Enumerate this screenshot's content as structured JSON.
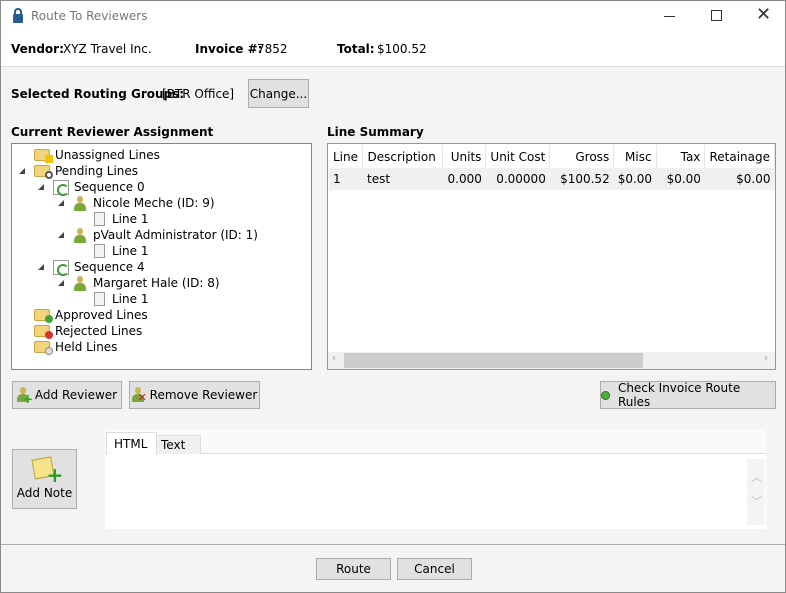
{
  "window": {
    "title": "Route To Reviewers",
    "controls": [
      "minimize",
      "maximize",
      "close"
    ]
  },
  "header": {
    "vendor_label": "Vendor:",
    "vendor": "XYZ Travel Inc.",
    "invoice_label": "Invoice #:",
    "invoice": "7852",
    "total_label": "Total:",
    "total": "$100.52"
  },
  "routing": {
    "label": "Selected Routing Groups:",
    "value": "[BTR Office]",
    "change_button": "Change..."
  },
  "tree": {
    "title": "Current Reviewer Assignment",
    "nodes": [
      {
        "label": "Unassigned Lines",
        "icon": "folder-warning-icon"
      },
      {
        "label": "Pending Lines",
        "icon": "folder-search-icon"
      },
      {
        "label": "Sequence 0",
        "icon": "sequence-icon"
      },
      {
        "label": "Nicole Meche (ID: 9)",
        "icon": "user-icon"
      },
      {
        "label": "Line 1",
        "icon": "document-icon"
      },
      {
        "label": "pVault Administrator (ID: 1)",
        "icon": "user-icon"
      },
      {
        "label": "Line 1",
        "icon": "document-icon"
      },
      {
        "label": "Sequence 4",
        "icon": "sequence-icon"
      },
      {
        "label": "Margaret Hale (ID: 8)",
        "icon": "user-icon"
      },
      {
        "label": "Line 1",
        "icon": "document-icon"
      },
      {
        "label": "Approved Lines",
        "icon": "folder-approved-icon"
      },
      {
        "label": "Rejected Lines",
        "icon": "folder-rejected-icon"
      },
      {
        "label": "Held Lines",
        "icon": "folder-held-icon"
      }
    ]
  },
  "line_summary": {
    "title": "Line Summary",
    "columns": [
      "Line",
      "Description",
      "Units",
      "Unit Cost",
      "Gross",
      "Misc",
      "Tax",
      "Retainage"
    ],
    "rows": [
      [
        "1",
        "test",
        "0.000",
        "0.00000",
        "$100.52",
        "$0.00",
        "$0.00",
        "$0.00"
      ]
    ]
  },
  "buttons": {
    "add_reviewer": "Add Reviewer",
    "remove_reviewer": "Remove Reviewer",
    "check_rules": "Check Invoice Route Rules",
    "add_note": "Add Note",
    "route": "Route",
    "cancel": "Cancel"
  },
  "note": {
    "tabs": [
      "HTML",
      "Text"
    ],
    "active_tab": "HTML"
  }
}
